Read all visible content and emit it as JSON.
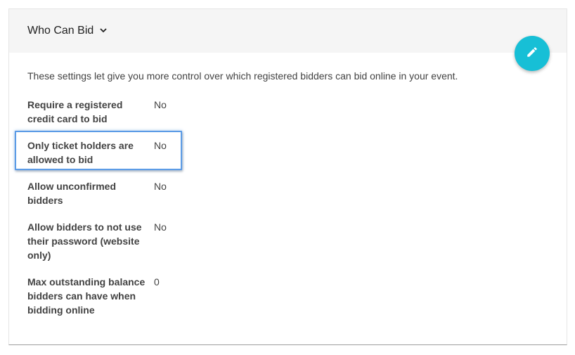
{
  "header": {
    "title": "Who Can Bid"
  },
  "description": "These settings let give you more control over which registered bidders can bid online in your event.",
  "settings": [
    {
      "label": "Require a registered credit card to bid",
      "value": "No"
    },
    {
      "label": "Only ticket holders are allowed to bid",
      "value": "No"
    },
    {
      "label": "Allow unconfirmed bidders",
      "value": "No"
    },
    {
      "label": "Allow bidders to not use their password (website only)",
      "value": "No"
    },
    {
      "label": "Max outstanding balance bidders can have when bidding online",
      "value": "0"
    }
  ],
  "colors": {
    "fab": "#17bfd6",
    "highlight": "#5b9be6",
    "header_bg": "#f5f5f5"
  },
  "icons": {
    "edit": "pencil-icon",
    "expand": "chevron-down-icon"
  }
}
